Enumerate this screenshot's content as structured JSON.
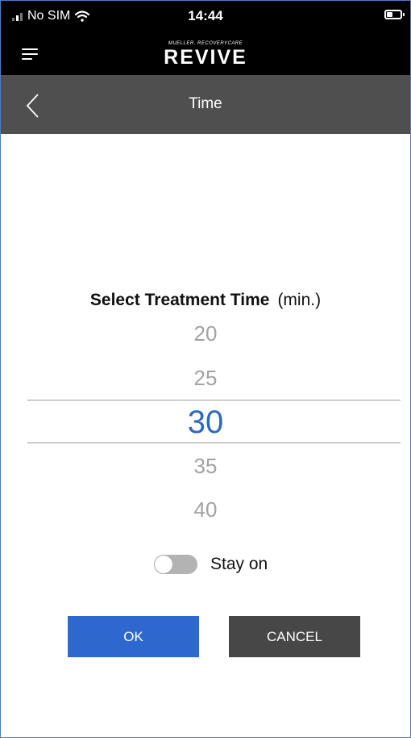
{
  "status_bar": {
    "carrier": "No SIM",
    "time": "14:44"
  },
  "header": {
    "logo_small": "MUELLER. RECOVERYCARE",
    "logo_big": "REVIVE"
  },
  "nav": {
    "title": "Time"
  },
  "picker": {
    "title": "Select Treatment Time",
    "unit": "(min.)",
    "options": [
      "20",
      "25",
      "30",
      "35",
      "40"
    ],
    "selected": "30"
  },
  "toggle": {
    "label": "Stay on",
    "on": false
  },
  "buttons": {
    "ok": "OK",
    "cancel": "CANCEL"
  },
  "colors": {
    "accent": "#2e68c2",
    "ok_button": "#2e68cf",
    "cancel_button": "#474747",
    "header": "#000000",
    "navbar": "#4f4f4f",
    "frame": "#4a7fc4"
  },
  "icons": [
    "signal-icon",
    "wifi-icon",
    "battery-icon",
    "menu-icon",
    "back-icon"
  ]
}
